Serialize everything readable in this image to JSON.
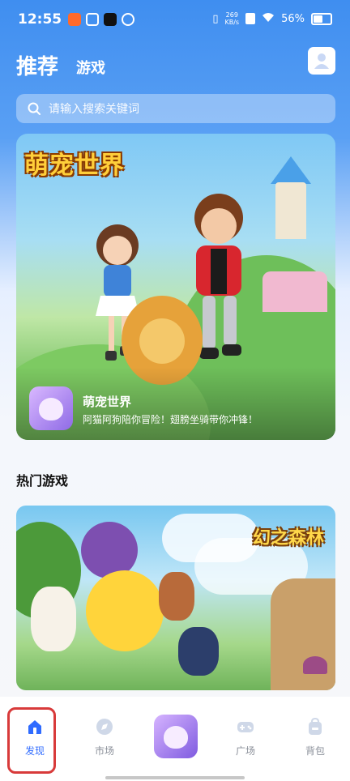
{
  "status_bar": {
    "time": "12:55",
    "speed_value": "269",
    "speed_unit": "KB/s",
    "battery": "56%"
  },
  "header": {
    "title": "推荐",
    "subtitle": "游戏"
  },
  "search": {
    "placeholder": "请输入搜索关键词"
  },
  "banner": {
    "logo_text": "萌宠世界",
    "app_name": "萌宠世界",
    "description": "阿猫阿狗陪你冒险！翅膀坐骑带你冲锋！"
  },
  "hot_games": {
    "section_title": "热门游戏",
    "featured_logo_text": "幻之森林"
  },
  "tabbar": {
    "items": [
      {
        "label": "发现",
        "active": true
      },
      {
        "label": "市场",
        "active": false
      },
      {
        "label": "",
        "active": false
      },
      {
        "label": "广场",
        "active": false
      },
      {
        "label": "背包",
        "active": false
      }
    ]
  },
  "colors": {
    "accent": "#2f6bff",
    "header_blue": "#3f8ef0",
    "highlight_red": "#d83a3a"
  }
}
